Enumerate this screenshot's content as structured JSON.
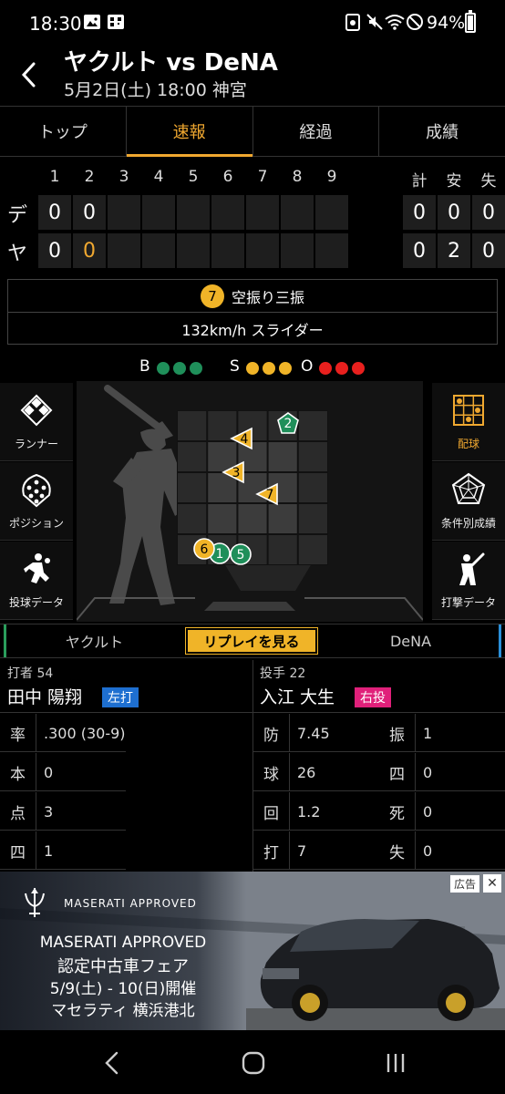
{
  "status_bar": {
    "time": "18:30",
    "battery": "94%"
  },
  "header": {
    "title": "ヤクルト vs DeNA",
    "subtitle": "5月2日(土) 18:00 神宮"
  },
  "tabs": [
    {
      "label": "トップ",
      "active": false
    },
    {
      "label": "速報",
      "active": true
    },
    {
      "label": "経過",
      "active": false
    },
    {
      "label": "成績",
      "active": false
    }
  ],
  "scoreboard": {
    "innings": [
      "1",
      "2",
      "3",
      "4",
      "5",
      "6",
      "7",
      "8",
      "9"
    ],
    "totals_headers": [
      "計",
      "安",
      "失"
    ],
    "teams": [
      {
        "label": "デ",
        "scores": [
          "0",
          "0",
          "",
          "",
          "",
          "",
          "",
          "",
          ""
        ],
        "totals": [
          "0",
          "0",
          "0"
        ]
      },
      {
        "label": "ヤ",
        "scores": [
          "0",
          "0",
          "",
          "",
          "",
          "",
          "",
          "",
          ""
        ],
        "totals": [
          "0",
          "2",
          "0"
        ]
      }
    ]
  },
  "play": {
    "pitch_number": "7",
    "result": "空振り三振",
    "detail": "132km/h スライダー"
  },
  "count": {
    "b_label": "B",
    "s_label": "S",
    "o_label": "O",
    "balls": 3,
    "strikes": 3,
    "outs": 3
  },
  "left_buttons": [
    "ランナー",
    "ポジション",
    "投球データ"
  ],
  "right_buttons": [
    "配球",
    "条件別成績",
    "打撃データ"
  ],
  "pitches": [
    {
      "n": "1",
      "kind": "circle",
      "color": "#1f8f5a"
    },
    {
      "n": "2",
      "kind": "pentagon",
      "color": "#1f8f5a"
    },
    {
      "n": "3",
      "kind": "triangle",
      "color": "#f0b428"
    },
    {
      "n": "4",
      "kind": "triangle",
      "color": "#f0b428"
    },
    {
      "n": "5",
      "kind": "circle",
      "color": "#1f8f5a"
    },
    {
      "n": "6",
      "kind": "circle",
      "color": "#f0b428"
    },
    {
      "n": "7",
      "kind": "triangle",
      "color": "#f0b428"
    }
  ],
  "replay": {
    "left_team": "ヤクルト",
    "button": "リプレイを見る",
    "right_team": "DeNA"
  },
  "batter": {
    "role": "打者 54",
    "name": "田中 陽翔",
    "hand": "左打",
    "stats": [
      {
        "label": "率",
        "value": ".300 (30-9)"
      },
      {
        "label": "本",
        "value": "0"
      },
      {
        "label": "点",
        "value": "3"
      },
      {
        "label": "四",
        "value": "1"
      }
    ]
  },
  "pitcher": {
    "role": "投手 22",
    "name": "入江 大生",
    "hand": "右投",
    "stats_left": [
      {
        "label": "防",
        "value": "7.45"
      },
      {
        "label": "球",
        "value": "26"
      },
      {
        "label": "回",
        "value": "1.2"
      },
      {
        "label": "打",
        "value": "7"
      }
    ],
    "stats_right": [
      {
        "label": "振",
        "value": "1"
      },
      {
        "label": "四",
        "value": "0"
      },
      {
        "label": "死",
        "value": "0"
      },
      {
        "label": "失",
        "value": "0"
      }
    ]
  },
  "ad": {
    "badge": "広告",
    "brand": "MASERATI APPROVED",
    "lines": [
      "MASERATI APPROVED",
      "認定中古車フェア",
      "5/9(土) - 10(日)開催",
      "マセラティ 横浜港北"
    ]
  },
  "colors": {
    "accent": "#f0a830",
    "ball": "#1f8f5a",
    "strike": "#f0b428",
    "out": "#e8201e",
    "lefty_badge": "#1e6fd0",
    "righty_badge": "#e0207a"
  }
}
